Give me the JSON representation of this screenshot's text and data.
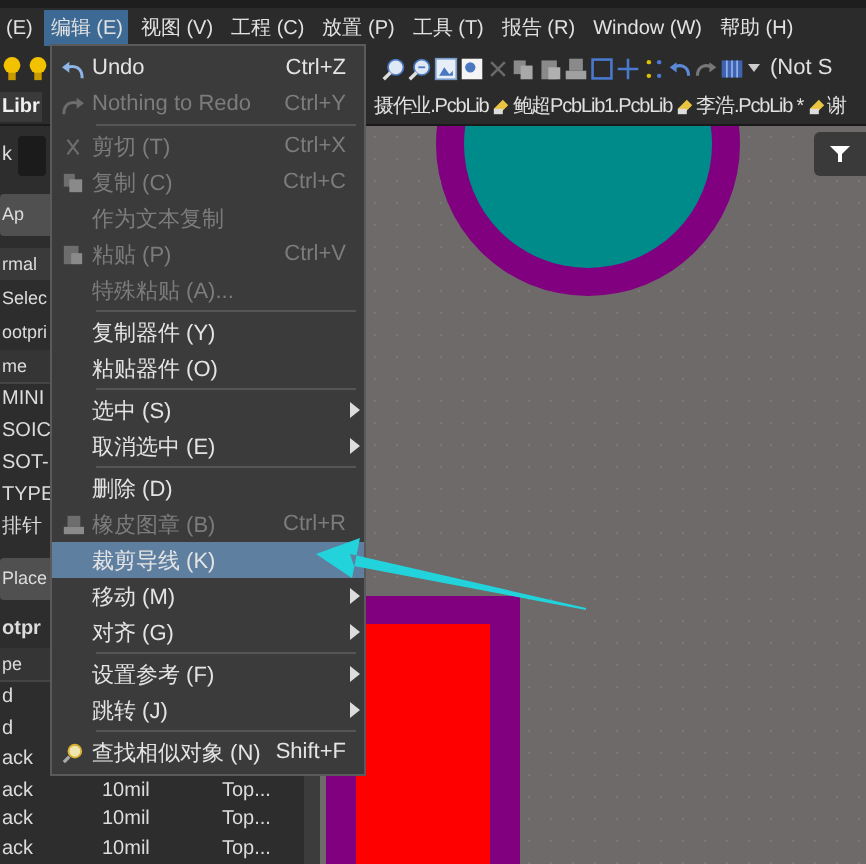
{
  "menu_bar": {
    "items": [
      {
        "label": "(E)",
        "selected": false
      },
      {
        "label": "编辑 (E)",
        "selected": true
      },
      {
        "label": "视图 (V)",
        "selected": false
      },
      {
        "label": "工程 (C)",
        "selected": false
      },
      {
        "label": "放置 (P)",
        "selected": false
      },
      {
        "label": "工具 (T)",
        "selected": false
      },
      {
        "label": "报告 (R)",
        "selected": false
      },
      {
        "label": "Window (W)",
        "selected": false
      },
      {
        "label": "帮助 (H)",
        "selected": false
      }
    ]
  },
  "toolbar": {
    "variant": "(Not S"
  },
  "panel": {
    "title": "Libr",
    "rows": [
      {
        "kind": "field",
        "label": "k"
      },
      {
        "kind": "button",
        "label": "Ap"
      },
      {
        "kind": "dropdown",
        "label": "rmal"
      },
      {
        "kind": "text",
        "label": "Selec"
      },
      {
        "kind": "text",
        "label": "ootpri"
      },
      {
        "kind": "column-header",
        "label": "me"
      },
      {
        "kind": "item",
        "label": "MINI"
      },
      {
        "kind": "item",
        "label": "SOIC"
      },
      {
        "kind": "item",
        "label": "SOT-"
      },
      {
        "kind": "item",
        "label": "TYPE"
      },
      {
        "kind": "item",
        "label": "排针"
      },
      {
        "kind": "button",
        "label": "Place"
      },
      {
        "kind": "header",
        "label": "otpr"
      },
      {
        "kind": "column-header",
        "label": "pe"
      },
      {
        "kind": "item",
        "label": "d"
      },
      {
        "kind": "item",
        "label": "d"
      },
      {
        "kind": "item",
        "label": "ack"
      },
      {
        "kind": "table-row",
        "cells": [
          "ack",
          "10mil",
          "Top..."
        ]
      },
      {
        "kind": "table-row",
        "cells": [
          "ack",
          "10mil",
          "Top..."
        ]
      },
      {
        "kind": "table-row",
        "cells": [
          "ack",
          "10mil",
          "Top..."
        ]
      }
    ]
  },
  "document_tabs": [
    {
      "label": "摄作业.PcbLib"
    },
    {
      "label": "鲍超PcbLib1.PcbLib"
    },
    {
      "label": "李浩.PcbLib *"
    },
    {
      "label": "谢"
    }
  ],
  "edit_menu": {
    "items": [
      {
        "kind": "item",
        "label": "Undo",
        "shortcut": "Ctrl+Z",
        "disabled": false,
        "highlighted": false,
        "submenu": false
      },
      {
        "kind": "item",
        "label": "Nothing to Redo",
        "shortcut": "Ctrl+Y",
        "disabled": true,
        "highlighted": false,
        "submenu": false
      },
      {
        "kind": "separator"
      },
      {
        "kind": "item",
        "label": "剪切 (T)",
        "shortcut": "Ctrl+X",
        "disabled": true,
        "highlighted": false,
        "submenu": false
      },
      {
        "kind": "item",
        "label": "复制 (C)",
        "shortcut": "Ctrl+C",
        "disabled": true,
        "highlighted": false,
        "submenu": false
      },
      {
        "kind": "item",
        "label": "作为文本复制",
        "disabled": true,
        "highlighted": false,
        "submenu": false
      },
      {
        "kind": "item",
        "label": "粘贴 (P)",
        "shortcut": "Ctrl+V",
        "disabled": true,
        "highlighted": false,
        "submenu": false
      },
      {
        "kind": "item",
        "label": "特殊粘贴 (A)...",
        "disabled": true,
        "highlighted": false,
        "submenu": false
      },
      {
        "kind": "separator"
      },
      {
        "kind": "item",
        "label": "复制器件 (Y)",
        "disabled": false,
        "highlighted": false,
        "submenu": false
      },
      {
        "kind": "item",
        "label": "粘贴器件 (O)",
        "disabled": false,
        "highlighted": false,
        "submenu": false
      },
      {
        "kind": "separator"
      },
      {
        "kind": "item",
        "label": "选中 (S)",
        "disabled": false,
        "highlighted": false,
        "submenu": true
      },
      {
        "kind": "item",
        "label": "取消选中 (E)",
        "disabled": false,
        "highlighted": false,
        "submenu": true
      },
      {
        "kind": "separator"
      },
      {
        "kind": "item",
        "label": "删除 (D)",
        "disabled": false,
        "highlighted": false,
        "submenu": false
      },
      {
        "kind": "item",
        "label": "橡皮图章 (B)",
        "shortcut": "Ctrl+R",
        "disabled": true,
        "highlighted": false,
        "submenu": false
      },
      {
        "kind": "item",
        "label": "裁剪导线 (K)",
        "disabled": false,
        "highlighted": true,
        "submenu": false
      },
      {
        "kind": "item",
        "label": "移动 (M)",
        "disabled": false,
        "highlighted": false,
        "submenu": true
      },
      {
        "kind": "item",
        "label": "对齐 (G)",
        "disabled": false,
        "highlighted": false,
        "submenu": true
      },
      {
        "kind": "separator"
      },
      {
        "kind": "item",
        "label": "设置参考 (F)",
        "disabled": false,
        "highlighted": false,
        "submenu": true
      },
      {
        "kind": "item",
        "label": "跳转 (J)",
        "disabled": false,
        "highlighted": false,
        "submenu": true
      },
      {
        "kind": "separator"
      },
      {
        "kind": "item",
        "label": "查找相似对象 (N)",
        "shortcut": "Shift+F",
        "disabled": false,
        "highlighted": false,
        "submenu": false
      }
    ]
  }
}
